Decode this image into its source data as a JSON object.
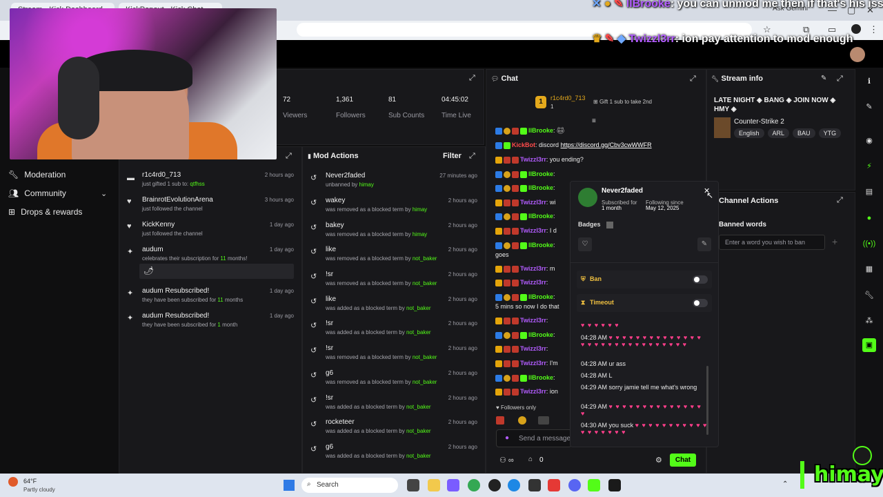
{
  "browser": {
    "tabs": [
      {
        "label": "Stream - Kick Dashboard"
      },
      {
        "label": "KickPopout - Kick Chat"
      }
    ],
    "ask_gemini": "Ask Gemini"
  },
  "overlay_chat": [
    {
      "user": "llBrooke",
      "text": "you can unmod me then if that's his issue"
    },
    {
      "user": "Twizzl3rr",
      "text": "ion pay attention to mod enough"
    }
  ],
  "stats": [
    {
      "value": "72",
      "label": "Viewers"
    },
    {
      "value": "1,361",
      "label": "Followers"
    },
    {
      "value": "81",
      "label": "Sub Counts"
    },
    {
      "value": "04:45:02",
      "label": "Time Live"
    }
  ],
  "nav": [
    {
      "label": "Moderation",
      "icon": "wrench-icon"
    },
    {
      "label": "Community",
      "icon": "people-icon"
    },
    {
      "label": "Drops & rewards",
      "icon": "gift-icon"
    }
  ],
  "events": [
    {
      "name": "r1c4rd0_713",
      "sub": "just gifted 1 sub to:",
      "target": "qtfhss",
      "time": "2 hours ago",
      "icon": "gift-icon"
    },
    {
      "name": "BrainrotEvolutionArena",
      "sub": "just followed the channel",
      "time": "3 hours ago",
      "icon": "heart-icon"
    },
    {
      "name": "KickKenny",
      "sub": "just followed the channel",
      "time": "1 day ago",
      "icon": "heart-icon"
    },
    {
      "name": "audum",
      "sub": "celebrates their subscription for",
      "months": "11",
      "months_suffix": "months!",
      "time": "1 day ago",
      "icon": "sparkle-icon"
    },
    {
      "name": "audum Resubscribed!",
      "sub": "they have been subscribed for",
      "months": "11",
      "months_suffix": "months",
      "time": "1 day ago",
      "icon": "sparkle-icon"
    },
    {
      "name": "audum Resubscribed!",
      "sub": "they have been subscribed for",
      "months": "1",
      "months_suffix": "month",
      "time": "1 day ago",
      "icon": "sparkle-icon"
    }
  ],
  "mod_actions": {
    "title": "Mod Actions",
    "filter": "Filter",
    "items": [
      {
        "name": "Never2faded",
        "sub": "unbanned by",
        "by": "himay",
        "time": "27 minutes ago"
      },
      {
        "name": "wakey",
        "sub": "was removed as a blocked term by",
        "by": "himay",
        "time": "2 hours ago"
      },
      {
        "name": "bakey",
        "sub": "was removed as a blocked term by",
        "by": "himay",
        "time": "2 hours ago"
      },
      {
        "name": "like",
        "sub": "was removed as a blocked term by",
        "by": "not_baker",
        "time": "2 hours ago"
      },
      {
        "name": "!sr",
        "sub": "was removed as a blocked term by",
        "by": "not_baker",
        "time": "2 hours ago"
      },
      {
        "name": "like",
        "sub": "was added as a blocked term by",
        "by": "not_baker",
        "time": "2 hours ago"
      },
      {
        "name": "!sr",
        "sub": "was added as a blocked term by",
        "by": "not_baker",
        "time": "2 hours ago"
      },
      {
        "name": "!sr",
        "sub": "was removed as a blocked term by",
        "by": "not_baker",
        "time": "2 hours ago"
      },
      {
        "name": "g6",
        "sub": "was removed as a blocked term by",
        "by": "not_baker",
        "time": "2 hours ago"
      },
      {
        "name": "!sr",
        "sub": "was added as a blocked term by",
        "by": "not_baker",
        "time": "2 hours ago"
      },
      {
        "name": "rocketeer",
        "sub": "was added as a blocked term by",
        "by": "not_baker",
        "time": "2 hours ago"
      },
      {
        "name": "g6",
        "sub": "was added as a blocked term by",
        "by": "not_baker",
        "time": "2 hours ago"
      }
    ]
  },
  "chat": {
    "title": "Chat",
    "pinned_user": "r1c4rd0_713",
    "pinned_count": "1",
    "gift_text": "Gift 1 sub to take 2nd",
    "lines": [
      {
        "user": "llBrooke",
        "cls": "u-green",
        "text": ""
      },
      {
        "user": "KickBot",
        "cls": "u-red",
        "text": "discord",
        "link": "https://discord.gg/Cbv3cwWWFR"
      },
      {
        "user": "Twizzl3rr",
        "cls": "u-purple",
        "text": "you ending?"
      },
      {
        "user": "llBrooke",
        "cls": "u-green",
        "text": ""
      },
      {
        "user": "llBrooke",
        "cls": "u-green",
        "text": ""
      },
      {
        "user": "Twizzl3rr",
        "cls": "u-purple",
        "text": "wi"
      },
      {
        "user": "llBrooke",
        "cls": "u-green",
        "text": ""
      },
      {
        "user": "Twizzl3rr",
        "cls": "u-purple",
        "text": "I d"
      },
      {
        "user": "llBrooke",
        "cls": "u-green",
        "text": ""
      },
      {
        "user": "",
        "cls": "",
        "text": "goes"
      },
      {
        "user": "Twizzl3rr",
        "cls": "u-purple",
        "text": "m"
      },
      {
        "user": "Twizzl3rr",
        "cls": "u-purple",
        "text": ""
      },
      {
        "user": "llBrooke",
        "cls": "u-green",
        "text": ""
      },
      {
        "user": "",
        "cls": "",
        "text": "5 mins so now I do that"
      },
      {
        "user": "Twizzl3rr",
        "cls": "u-purple",
        "text": ""
      },
      {
        "user": "llBrooke",
        "cls": "u-green",
        "text": ""
      },
      {
        "user": "Twizzl3rr",
        "cls": "u-purple",
        "text": ""
      },
      {
        "user": "Twizzl3rr",
        "cls": "u-purple",
        "text": "I'm"
      },
      {
        "user": "llBrooke",
        "cls": "u-green",
        "text": ""
      },
      {
        "user": "Twizzl3rr",
        "cls": "u-purple",
        "text": "ion"
      }
    ],
    "followers_only": "Followers only",
    "send_placeholder": "Send a message",
    "points": "0",
    "chat_button": "Chat"
  },
  "popup": {
    "username": "Never2faded",
    "subscribed_for_label": "Subscribed for",
    "subscribed_for": "1 month",
    "following_since_label": "Following since",
    "following_since": "May 12, 2025",
    "badges_label": "Badges",
    "ban_label": "Ban",
    "timeout_label": "Timeout",
    "messages": [
      {
        "time": "",
        "text": "",
        "hearts": "♥ ♥ ♥ ♥ ♥ ♥"
      },
      {
        "time": "04:28 AM",
        "text": "",
        "hearts": "♥ ♥ ♥ ♥ ♥ ♥ ♥ ♥ ♥ ♥ ♥ ♥ ♥ ♥ ♥ ♥ ♥ ♥ ♥ ♥ ♥ ♥ ♥ ♥ ♥ ♥ ♥ ♥ ♥ ♥"
      },
      {
        "time": "04:28 AM",
        "text": "ur ass",
        "hearts": ""
      },
      {
        "time": "04:28 AM",
        "text": "L",
        "hearts": ""
      },
      {
        "time": "04:29 AM",
        "text": "sorry jamie tell me what's wrong",
        "hearts": ""
      },
      {
        "time": "04:29 AM",
        "text": "",
        "hearts": "♥ ♥ ♥ ♥ ♥ ♥ ♥ ♥ ♥ ♥ ♥ ♥ ♥ ♥ ♥"
      },
      {
        "time": "04:30 AM",
        "text": "you suck",
        "hearts": "♥ ♥ ♥ ♥ ♥ ♥ ♥ ♥ ♥ ♥ ♥ ♥ ♥ ♥ ♥ ♥ ♥ ♥"
      }
    ]
  },
  "stream_info": {
    "title_label": "Stream info",
    "stream_title": "LATE NIGHT ◈ BANG ◈ JOIN NOW ◈ HMY ◈",
    "category": "Counter-Strike 2",
    "tags": [
      "English",
      "ARL",
      "BAU",
      "YTG"
    ]
  },
  "channel_actions": {
    "title": "Channel Actions",
    "banned_words": "Banned words",
    "input_placeholder": "Enter a word you wish to ban"
  },
  "taskbar": {
    "temp": "64°F",
    "weather": "Partly cloudy",
    "search": "Search"
  },
  "watermark": "himay",
  "colors": {
    "kick_green": "#53fc18",
    "panel": "#18181b",
    "mod_blue": "#2c7be5",
    "sub_purple": "#b35cff"
  }
}
